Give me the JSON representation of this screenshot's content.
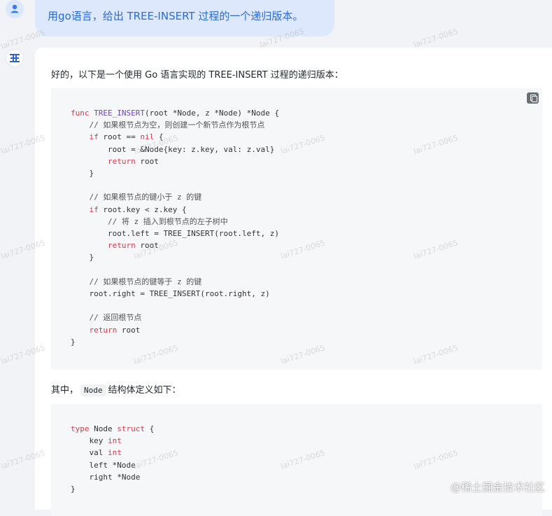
{
  "user_message": "用go语言，给出 TREE-INSERT 过程的一个递归版本。",
  "answer": {
    "intro": "好的，以下是一个使用 Go 语言实现的 TREE-INSERT 过程的递归版本：",
    "code1": [
      "func TREE_INSERT(root *Node, z *Node) *Node {",
      "    // 如果根节点为空，则创建一个新节点作为根节点",
      "    if root == nil {",
      "        root = &Node{key: z.key, val: z.val}",
      "        return root",
      "    }",
      "",
      "    // 如果根节点的键小于 z 的键",
      "    if root.key < z.key {",
      "        // 将 z 插入到根节点的左子树中",
      "        root.left = TREE_INSERT(root.left, z)",
      "        return root",
      "    }",
      "",
      "    // 如果根节点的键等于 z 的键",
      "    root.right = TREE_INSERT(root.right, z)",
      "",
      "    // 返回根节点",
      "    return root",
      "}"
    ],
    "mid_prefix": "其中，",
    "mid_code": "Node",
    "mid_suffix": "结构体定义如下：",
    "code2": [
      "type Node struct {",
      "    key int",
      "    val int",
      "    left *Node",
      "    right *Node",
      "}"
    ]
  },
  "watermark": "lai727-0065",
  "brand": "@稀土掘金技术社区",
  "icons": {
    "user_avatar": "user-icon",
    "bot_avatar": "bot-logo-icon",
    "copy": "copy-icon"
  },
  "colors": {
    "user_text": "#2c6bd6",
    "user_bubble": "#dde8fd",
    "keyword": "#d73a49",
    "function": "#6f42c1"
  }
}
